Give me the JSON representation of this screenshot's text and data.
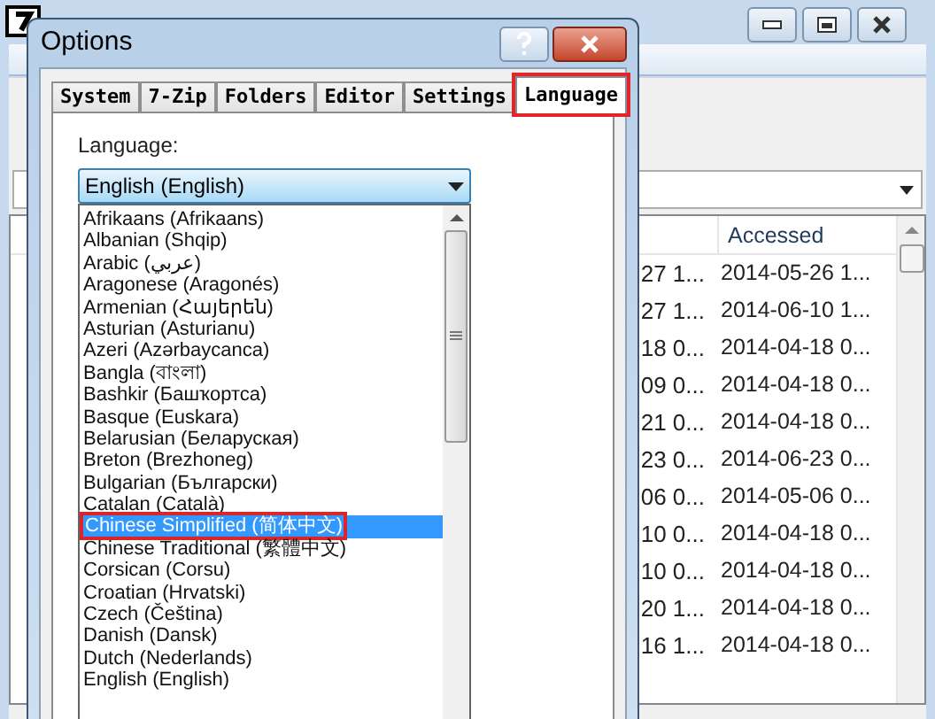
{
  "dialog": {
    "title": "Options",
    "tabs": [
      {
        "label": "System",
        "selected": false,
        "annotated": false
      },
      {
        "label": "7-Zip",
        "selected": false,
        "annotated": false
      },
      {
        "label": "Folders",
        "selected": false,
        "annotated": false
      },
      {
        "label": "Editor",
        "selected": false,
        "annotated": false
      },
      {
        "label": "Settings",
        "selected": false,
        "annotated": false
      },
      {
        "label": "Language",
        "selected": true,
        "annotated": true
      }
    ],
    "language_label": "Language:",
    "language_select": {
      "value": "English (English)",
      "expanded": true
    },
    "options": [
      {
        "label": "Afrikaans (Afrikaans)",
        "selected": false,
        "annotated": false
      },
      {
        "label": "Albanian (Shqip)",
        "selected": false,
        "annotated": false
      },
      {
        "label": "Arabic (عربي)",
        "selected": false,
        "annotated": false
      },
      {
        "label": "Aragonese (Aragonés)",
        "selected": false,
        "annotated": false
      },
      {
        "label": "Armenian (Հայերեն)",
        "selected": false,
        "annotated": false
      },
      {
        "label": "Asturian (Asturianu)",
        "selected": false,
        "annotated": false
      },
      {
        "label": "Azeri (Azərbaycanca)",
        "selected": false,
        "annotated": false
      },
      {
        "label": "Bangla (বাংলা)",
        "selected": false,
        "annotated": false
      },
      {
        "label": "Bashkir (Башҡортса)",
        "selected": false,
        "annotated": false
      },
      {
        "label": "Basque (Euskara)",
        "selected": false,
        "annotated": false
      },
      {
        "label": "Belarusian (Беларуская)",
        "selected": false,
        "annotated": false
      },
      {
        "label": "Breton (Brezhoneg)",
        "selected": false,
        "annotated": false
      },
      {
        "label": "Bulgarian (Български)",
        "selected": false,
        "annotated": false
      },
      {
        "label": "Catalan (Català)",
        "selected": false,
        "annotated": false
      },
      {
        "label": "Chinese Simplified (简体中文)",
        "selected": true,
        "annotated": true
      },
      {
        "label": "Chinese Traditional (繁體中文)",
        "selected": false,
        "annotated": false
      },
      {
        "label": "Corsican (Corsu)",
        "selected": false,
        "annotated": false
      },
      {
        "label": "Croatian (Hrvatski)",
        "selected": false,
        "annotated": false
      },
      {
        "label": "Czech (Čeština)",
        "selected": false,
        "annotated": false
      },
      {
        "label": "Danish (Dansk)",
        "selected": false,
        "annotated": false
      },
      {
        "label": "Dutch (Nederlands)",
        "selected": false,
        "annotated": false
      },
      {
        "label": "English (English)",
        "selected": false,
        "annotated": false
      }
    ]
  },
  "file_list": {
    "columns": [
      "Accessed"
    ],
    "rows": [
      {
        "column_1": "27 1...",
        "accessed": "2014-05-26 1..."
      },
      {
        "column_1": "27 1...",
        "accessed": "2014-06-10 1..."
      },
      {
        "column_1": "18 0...",
        "accessed": "2014-04-18 0..."
      },
      {
        "column_1": "09 0...",
        "accessed": "2014-04-18 0..."
      },
      {
        "column_1": "21 0...",
        "accessed": "2014-04-18 0..."
      },
      {
        "column_1": "23 0...",
        "accessed": "2014-06-23 0..."
      },
      {
        "column_1": "06 0...",
        "accessed": "2014-05-06 0..."
      },
      {
        "column_1": "10 0...",
        "accessed": "2014-04-18 0..."
      },
      {
        "column_1": "10 0...",
        "accessed": "2014-04-18 0..."
      },
      {
        "column_1": "20 1...",
        "accessed": "2014-04-18 0..."
      },
      {
        "column_1": "16 1...",
        "accessed": "2014-04-18 0..."
      }
    ]
  }
}
